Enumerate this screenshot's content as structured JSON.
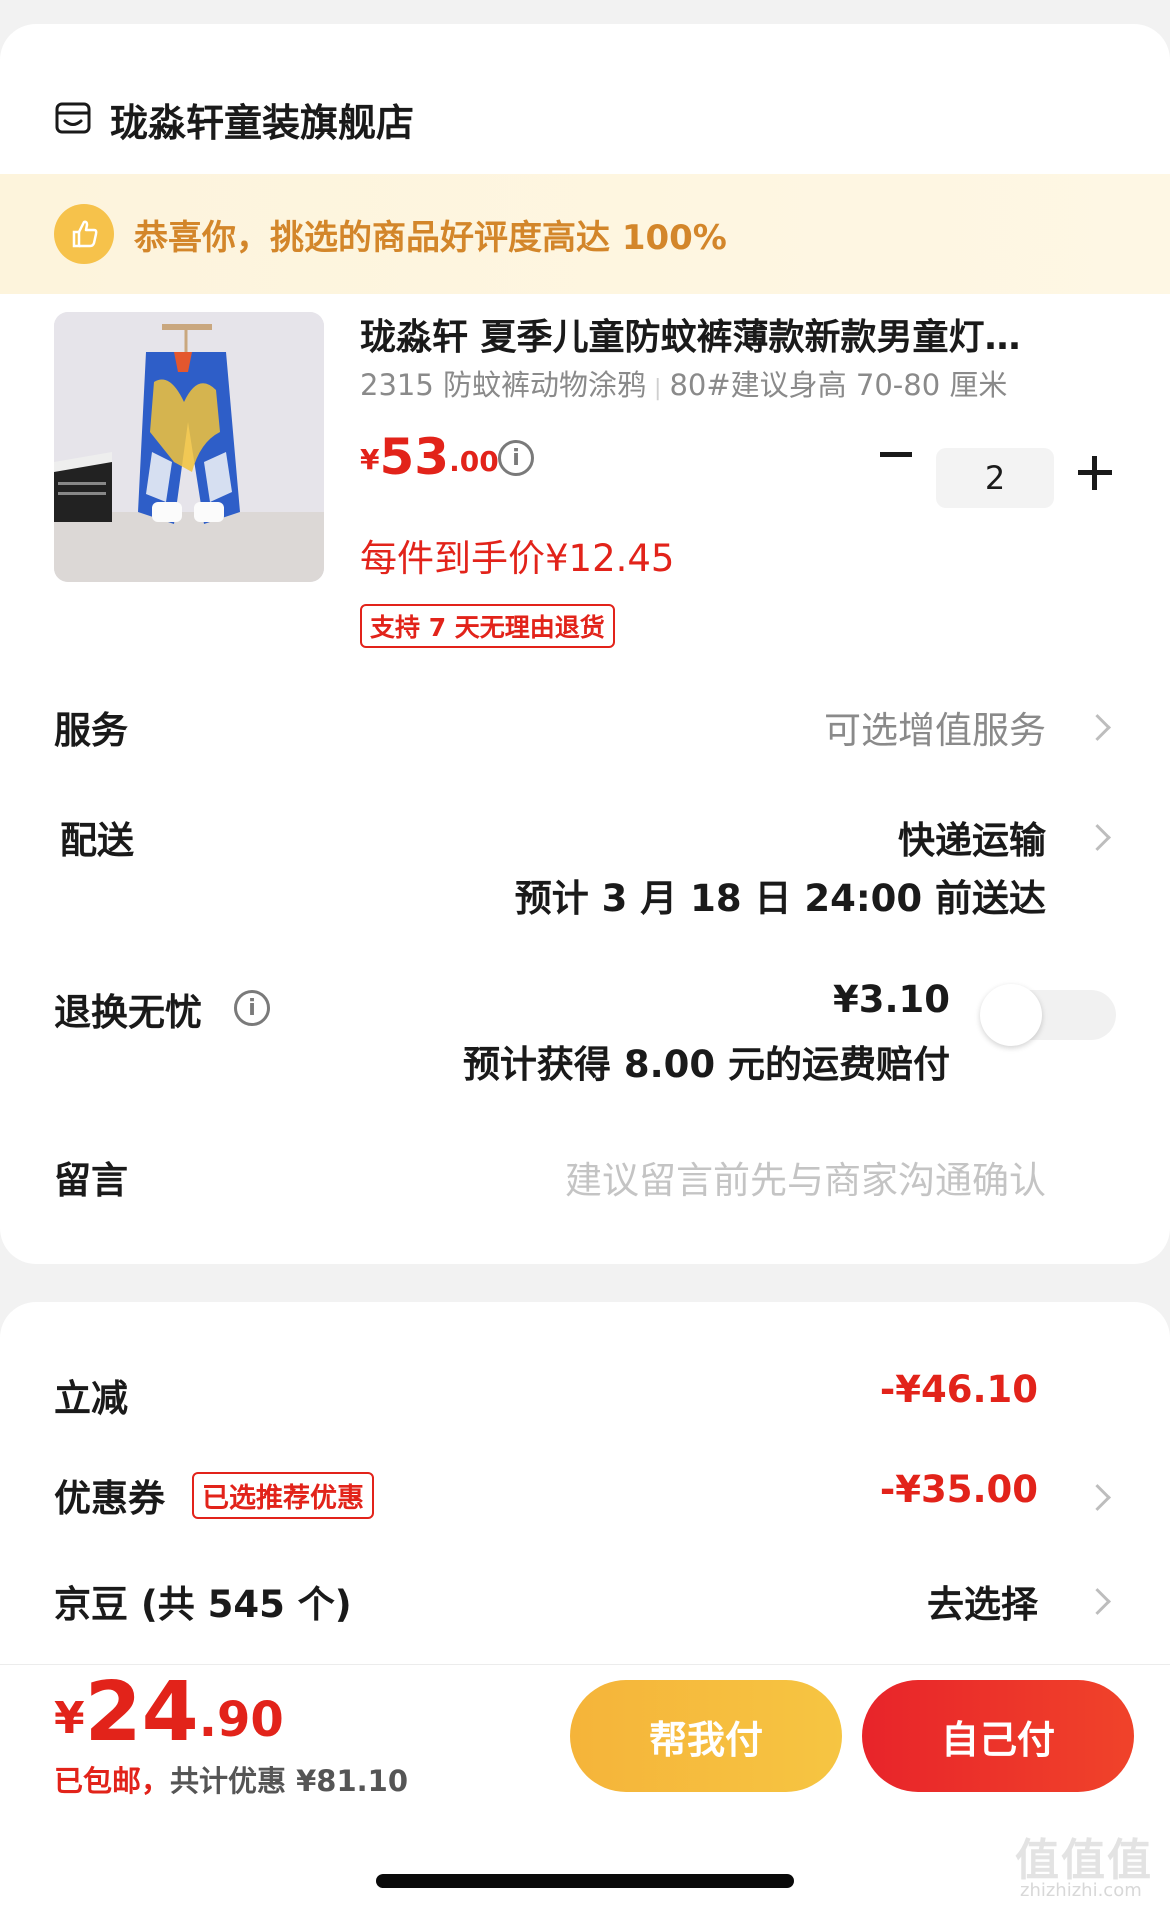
{
  "shop": {
    "name": "珑淼轩童装旗舰店",
    "icon": "shop-icon"
  },
  "praise": {
    "text": "恭喜你，挑选的商品好评度高达 100%",
    "icon": "thumbs-up-icon"
  },
  "product": {
    "title": "珑淼轩 夏季儿童防蚊裤薄款新款男童灯…",
    "spec_style": "2315 防蚊裤动物涂鸦",
    "spec_size": "80#建议身高 70-80 厘米",
    "price_symbol": "¥",
    "price_int": "53",
    "price_dec": ".00",
    "unit_price": "每件到手价¥12.45",
    "return_tag": "支持 7 天无理由退货",
    "quantity": "2"
  },
  "service": {
    "label": "服务",
    "value": "可选增值服务"
  },
  "delivery": {
    "label": "配送",
    "method": "快递运输",
    "eta": "预计 3 月 18 日 24:00 前送达"
  },
  "return_insurance": {
    "label": "退换无忧",
    "price": "¥3.10",
    "note": "预计获得 8.00 元的运费赔付",
    "enabled": false
  },
  "message": {
    "label": "留言",
    "placeholder": "建议留言前先与商家沟通确认"
  },
  "discounts": {
    "instant": {
      "label": "立减",
      "value": "-¥46.10"
    },
    "coupon": {
      "label": "优惠券",
      "tag": "已选推荐优惠",
      "value": "-¥35.00"
    },
    "jingdou": {
      "label": "京豆 (共 545 个)",
      "value": "去选择"
    }
  },
  "footer": {
    "total_symbol": "¥",
    "total_int": "24",
    "total_dec": ".90",
    "shipping": "已包邮，",
    "saving": "共计优惠 ¥81.10",
    "help_pay": "帮我付",
    "self_pay": "自己付"
  },
  "watermark": {
    "text": "值值值",
    "url": "zhizhizhi.com"
  },
  "colors": {
    "accent_red": "#e2231a",
    "gold": "#d3862a",
    "help_btn": "#f5b43a"
  }
}
